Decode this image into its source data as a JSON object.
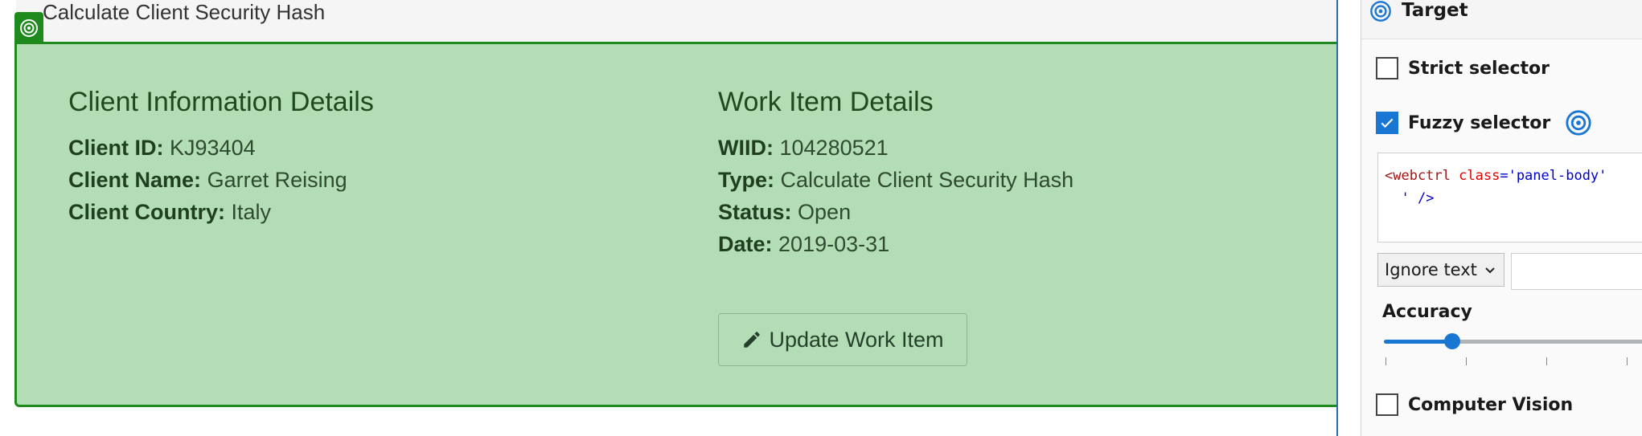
{
  "panel": {
    "title": "Calculate Client Security Hash"
  },
  "client": {
    "heading": "Client Information Details",
    "fields": [
      {
        "label": "Client ID:",
        "value": "KJ93404"
      },
      {
        "label": "Client Name:",
        "value": "Garret Reising"
      },
      {
        "label": "Client Country:",
        "value": "Italy"
      }
    ]
  },
  "work_item": {
    "heading": "Work Item Details",
    "fields": [
      {
        "label": "WIID:",
        "value": "104280521"
      },
      {
        "label": "Type:",
        "value": "Calculate Client Security Hash"
      },
      {
        "label": "Status:",
        "value": "Open"
      },
      {
        "label": "Date:",
        "value": "2019-03-31"
      }
    ],
    "update_button": "Update Work Item"
  },
  "selector_panel": {
    "header": "Target",
    "strict_selector": {
      "label": "Strict selector",
      "checked": false
    },
    "fuzzy_selector": {
      "label": "Fuzzy selector",
      "checked": true
    },
    "code": {
      "tag_open": "<webctrl",
      "attr": "class",
      "eq": "=",
      "value": "'panel-body'",
      "line2_str": "  '",
      "line2_close": " />"
    },
    "ignore_text_option": "Ignore text",
    "accuracy_label": "Accuracy",
    "accuracy_fraction": 0.25,
    "computer_vision": {
      "label": "Computer Vision",
      "checked": false
    }
  },
  "colors": {
    "panel_bg": "#b3ddb5",
    "panel_border": "#1e8a1e",
    "accent_blue": "#1976d2"
  }
}
